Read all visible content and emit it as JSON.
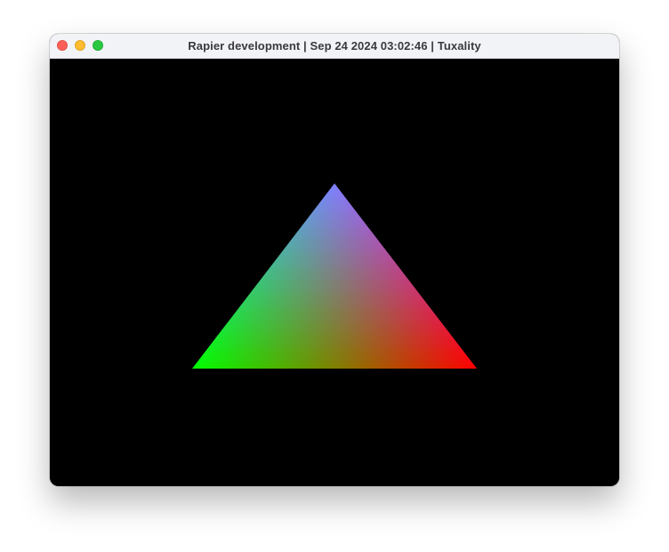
{
  "window": {
    "title": "Rapier development | Sep 24 2024 03:02:46 | Tuxality",
    "controls": [
      "close-button",
      "minimize-button",
      "zoom-button"
    ],
    "colors": {
      "titlebar": "#f2f3f7",
      "close": "#ff5f57",
      "minimize": "#febc2e",
      "zoom": "#28c840",
      "canvas": "#000000"
    }
  },
  "scene": {
    "object": "triangle",
    "vertex_colors": {
      "top": "#0000ff",
      "left": "#00ff00",
      "right": "#ff0000"
    }
  }
}
